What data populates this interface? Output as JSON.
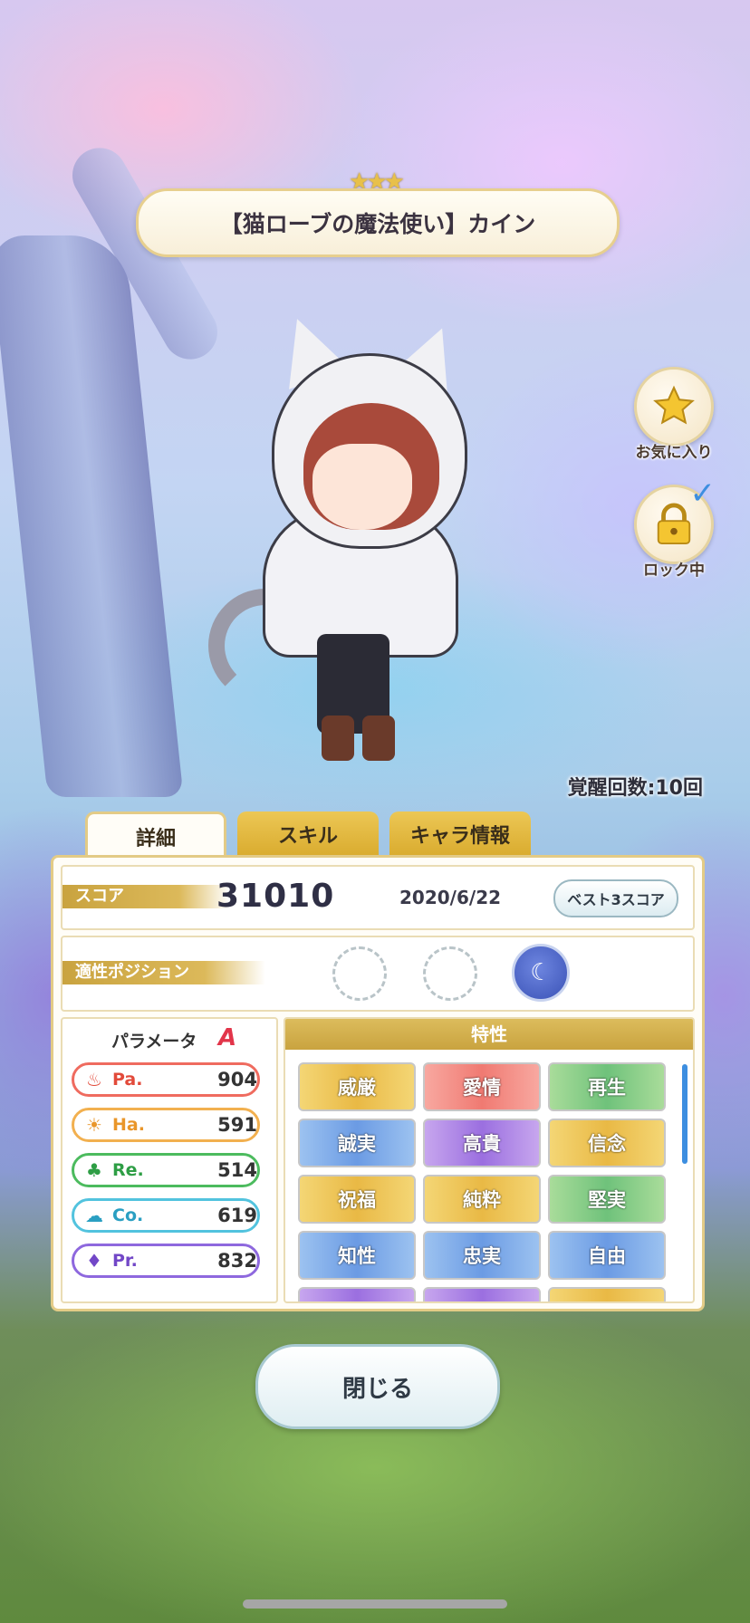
{
  "header": {
    "rarity_stars": "★★★",
    "title": "【猫ローブの魔法使い】カイン"
  },
  "side": {
    "favorite_label": "お気に入り",
    "lock_label": "ロック中"
  },
  "awakening": "覚醒回数:10回",
  "tabs": [
    {
      "label": "詳細",
      "active": true
    },
    {
      "label": "スキル",
      "active": false
    },
    {
      "label": "キャラ情報",
      "active": false
    }
  ],
  "score": {
    "label": "スコア",
    "value": "31010",
    "date": "2020/6/22",
    "best_button": "ベスト3スコア"
  },
  "position": {
    "label": "適性ポジション"
  },
  "parameters": {
    "title": "パラメータ",
    "rank": "A",
    "items": [
      {
        "name": "Pa.",
        "value": "904",
        "icon": "flame-icon",
        "color": "#e24a3a"
      },
      {
        "name": "Ha.",
        "value": "591",
        "icon": "sun-icon",
        "color": "#e9962a"
      },
      {
        "name": "Re.",
        "value": "514",
        "icon": "clover-icon",
        "color": "#2e9e45"
      },
      {
        "name": "Co.",
        "value": "619",
        "icon": "swirl-icon",
        "color": "#2a9fc2"
      },
      {
        "name": "Pr.",
        "value": "832",
        "icon": "diamond-icon",
        "color": "#7247c7"
      }
    ]
  },
  "traits": {
    "title": "特性",
    "items": [
      "威厳",
      "愛情",
      "再生",
      "誠実",
      "高貴",
      "信念",
      "祝福",
      "純粋",
      "堅実",
      "知性",
      "忠実",
      "自由"
    ]
  },
  "close_button": "閉じる"
}
